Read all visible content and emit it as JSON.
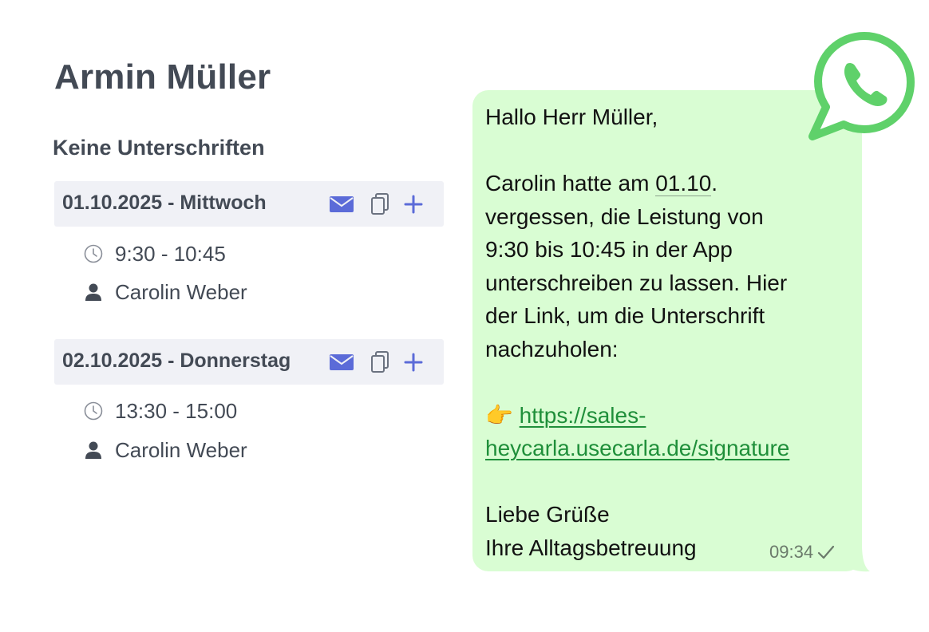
{
  "customer": {
    "name": "Armin Müller",
    "status": "Keine Unterschriften"
  },
  "days": [
    {
      "title": "01.10.2025 - Mittwoch",
      "time": "9:30 - 10:45",
      "person": "Carolin Weber",
      "actions": [
        "mail-icon",
        "copy-icon",
        "plus-icon"
      ]
    },
    {
      "title": "02.10.2025 - Donnerstag",
      "time": "13:30 - 15:00",
      "person": "Carolin Weber",
      "actions": [
        "mail-icon",
        "copy-icon",
        "plus-icon"
      ]
    }
  ],
  "message": {
    "greeting": "Hallo Herr Müller,",
    "body_pre_date": "Carolin hatte am ",
    "body_date": "01.10",
    "body_post_date": ".",
    "body_lines": [
      "vergessen, die Leistung von",
      "9:30 bis 10:45 in der App",
      "unterschreiben zu lassen. Hier",
      "der Link, um die Unterschrift",
      "nachzuholen:"
    ],
    "pointer_emoji": "👉",
    "link_line1": "https://sales-",
    "link_line2": "heycarla.usecarla.de/signature",
    "closing": "Liebe Grüße",
    "signature": "Ihre Alltagsbetreuung",
    "time": "09:34"
  },
  "colors": {
    "accent": "#5b6bd8",
    "bubble": "#d9fdd3",
    "whatsapp": "#5fd16a",
    "link": "#1f8f3a",
    "header_bg": "#f0f1f6"
  },
  "icons": {
    "brand": "whatsapp-icon",
    "time": "clock-icon",
    "person": "person-icon",
    "status": "check-icon"
  }
}
